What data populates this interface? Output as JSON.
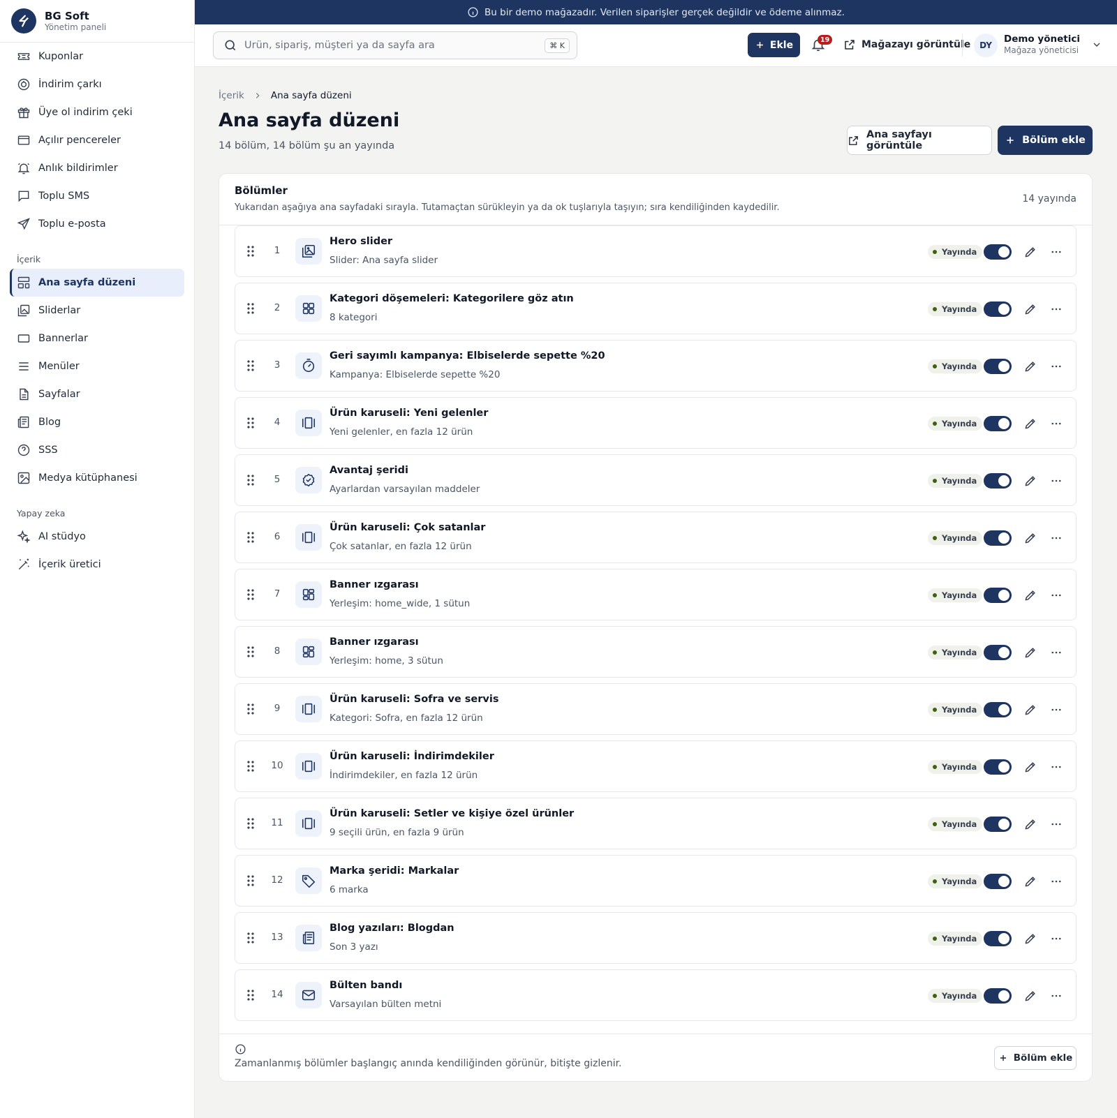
{
  "brand": {
    "name": "BG Soft",
    "subtitle": "Yönetim paneli"
  },
  "sidebar": {
    "top_items": [
      {
        "label": "Kuponlar",
        "icon": "ticket-icon"
      },
      {
        "label": "İndirim çarkı",
        "icon": "wheel-icon"
      },
      {
        "label": "Üye ol indirim çeki",
        "icon": "gift-icon"
      },
      {
        "label": "Açılır pencereler",
        "icon": "window-icon"
      },
      {
        "label": "Anlık bildirimler",
        "icon": "bell-ring-icon"
      },
      {
        "label": "Toplu SMS",
        "icon": "message-icon"
      },
      {
        "label": "Toplu e-posta",
        "icon": "send-icon"
      }
    ],
    "content_group": "İçerik",
    "content_items": [
      {
        "label": "Ana sayfa düzeni",
        "icon": "layout-icon",
        "active": true
      },
      {
        "label": "Sliderlar",
        "icon": "images-icon"
      },
      {
        "label": "Bannerlar",
        "icon": "rectangle-icon"
      },
      {
        "label": "Menüler",
        "icon": "menu-icon"
      },
      {
        "label": "Sayfalar",
        "icon": "file-icon"
      },
      {
        "label": "Blog",
        "icon": "newspaper-icon"
      },
      {
        "label": "SSS",
        "icon": "help-circle-icon"
      },
      {
        "label": "Medya kütüphanesi",
        "icon": "image-icon"
      }
    ],
    "ai_group": "Yapay zeka",
    "ai_items": [
      {
        "label": "AI stüdyo",
        "icon": "sparkles-icon"
      },
      {
        "label": "İçerik üretici",
        "icon": "wand-icon"
      }
    ]
  },
  "demo_banner": "Bu bir demo mağazadır. Verilen siparişler gerçek değildir ve ödeme alınmaz.",
  "topbar": {
    "search_placeholder": "Ürün, sipariş, müşteri ya da sayfa ara",
    "shortcut": "⌘ K",
    "add_label": "Ekle",
    "notification_count": "19",
    "view_store_label": "Mağazayı görüntüle",
    "user_initials": "DY",
    "user_name": "Demo yönetici",
    "user_role": "Mağaza yöneticisi"
  },
  "breadcrumb": {
    "parent": "İçerik",
    "current": "Ana sayfa düzeni"
  },
  "page": {
    "title": "Ana sayfa düzeni",
    "subtitle": "14 bölüm, 14 bölüm şu an yayında",
    "view_home_label": "Ana sayfayı görüntüle",
    "add_section_label": "Bölüm ekle"
  },
  "sections": {
    "title": "Bölümler",
    "description": "Yukarıdan aşağıya ana sayfadaki sırayla. Tutamaçtan sürükleyin ya da ok tuşlarıyla taşıyın; sıra kendiliğinden kaydedilir.",
    "count_label": "14 yayında",
    "status_label": "Yayında",
    "items": [
      {
        "index": "1",
        "title": "Hero slider",
        "subtitle": "Slider: Ana sayfa slider",
        "icon": "slider-icon",
        "published": true
      },
      {
        "index": "2",
        "title": "Kategori döşemeleri: Kategorilere göz atın",
        "subtitle": "8 kategori",
        "icon": "grid-icon",
        "published": true
      },
      {
        "index": "3",
        "title": "Geri sayımlı kampanya: Elbiselerde sepette %20",
        "subtitle": "Kampanya: Elbiselerde sepette %20",
        "icon": "timer-icon",
        "published": true
      },
      {
        "index": "4",
        "title": "Ürün karuseli: Yeni gelenler",
        "subtitle": "Yeni gelenler, en fazla 12 ürün",
        "icon": "carousel-icon",
        "published": true
      },
      {
        "index": "5",
        "title": "Avantaj şeridi",
        "subtitle": "Ayarlardan varsayılan maddeler",
        "icon": "badge-check-icon",
        "published": true
      },
      {
        "index": "6",
        "title": "Ürün karuseli: Çok satanlar",
        "subtitle": "Çok satanlar, en fazla 12 ürün",
        "icon": "carousel-icon",
        "published": true
      },
      {
        "index": "7",
        "title": "Banner ızgarası",
        "subtitle": "Yerleşim: home_wide, 1 sütun",
        "icon": "dashboard-icon",
        "published": true
      },
      {
        "index": "8",
        "title": "Banner ızgarası",
        "subtitle": "Yerleşim: home, 3 sütun",
        "icon": "dashboard-icon",
        "published": true
      },
      {
        "index": "9",
        "title": "Ürün karuseli: Sofra ve servis",
        "subtitle": "Kategori: Sofra, en fazla 12 ürün",
        "icon": "carousel-icon",
        "published": true
      },
      {
        "index": "10",
        "title": "Ürün karuseli: İndirimdekiler",
        "subtitle": "İndirimdekiler, en fazla 12 ürün",
        "icon": "carousel-icon",
        "published": true
      },
      {
        "index": "11",
        "title": "Ürün karuseli: Setler ve kişiye özel ürünler",
        "subtitle": "9 seçili ürün, en fazla 9 ürün",
        "icon": "carousel-icon",
        "published": true
      },
      {
        "index": "12",
        "title": "Marka şeridi: Markalar",
        "subtitle": "6 marka",
        "icon": "tag-icon",
        "published": true
      },
      {
        "index": "13",
        "title": "Blog yazıları: Blogdan",
        "subtitle": "Son 3 yazı",
        "icon": "newspaper-icon",
        "published": true
      },
      {
        "index": "14",
        "title": "Bülten bandı",
        "subtitle": "Varsayılan bülten metni",
        "icon": "mail-icon",
        "published": true
      }
    ],
    "footer_note": "Zamanlanmış bölümler başlangıç anında kendiliğinden görünür, bitişte gizlenir.",
    "footer_add_label": "Bölüm ekle"
  },
  "colors": {
    "primary": "#1e3561",
    "status_dot": "#3f6212",
    "badge": "#b91c1c"
  }
}
